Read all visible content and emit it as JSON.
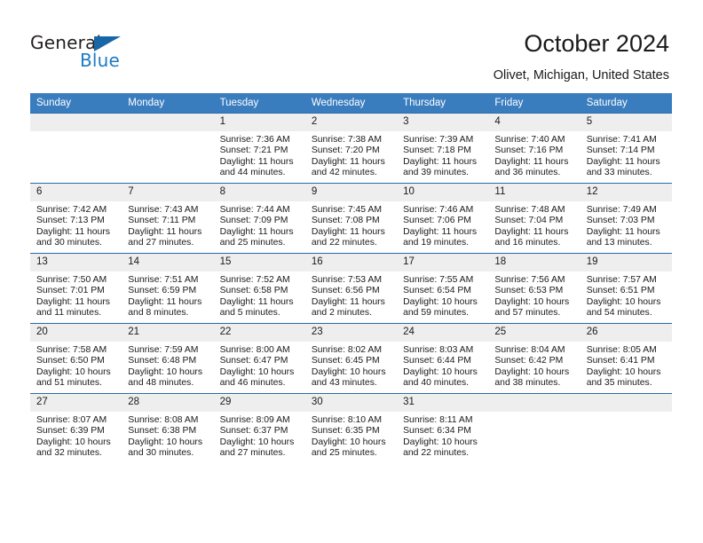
{
  "brand": {
    "name_part1": "General",
    "name_part2": "Blue",
    "logo_icon": "triangle-flag-icon",
    "accent_color": "#1b7bc4"
  },
  "header": {
    "title": "October 2024",
    "subtitle": "Olivet, Michigan, United States"
  },
  "colors": {
    "header_row": "#3a7dbf",
    "day_number_bg": "#eeeeee",
    "row_divider": "#2a6ba8",
    "text": "#1a1a1a"
  },
  "calendar": {
    "weekday_headers": [
      "Sunday",
      "Monday",
      "Tuesday",
      "Wednesday",
      "Thursday",
      "Friday",
      "Saturday"
    ],
    "weeks": [
      [
        {
          "day": "",
          "blank": true,
          "sunrise": "",
          "sunset": "",
          "daylight_line1": "",
          "daylight_line2": ""
        },
        {
          "day": "",
          "blank": true,
          "sunrise": "",
          "sunset": "",
          "daylight_line1": "",
          "daylight_line2": ""
        },
        {
          "day": "1",
          "blank": false,
          "sunrise": "Sunrise: 7:36 AM",
          "sunset": "Sunset: 7:21 PM",
          "daylight_line1": "Daylight: 11 hours",
          "daylight_line2": "and 44 minutes."
        },
        {
          "day": "2",
          "blank": false,
          "sunrise": "Sunrise: 7:38 AM",
          "sunset": "Sunset: 7:20 PM",
          "daylight_line1": "Daylight: 11 hours",
          "daylight_line2": "and 42 minutes."
        },
        {
          "day": "3",
          "blank": false,
          "sunrise": "Sunrise: 7:39 AM",
          "sunset": "Sunset: 7:18 PM",
          "daylight_line1": "Daylight: 11 hours",
          "daylight_line2": "and 39 minutes."
        },
        {
          "day": "4",
          "blank": false,
          "sunrise": "Sunrise: 7:40 AM",
          "sunset": "Sunset: 7:16 PM",
          "daylight_line1": "Daylight: 11 hours",
          "daylight_line2": "and 36 minutes."
        },
        {
          "day": "5",
          "blank": false,
          "sunrise": "Sunrise: 7:41 AM",
          "sunset": "Sunset: 7:14 PM",
          "daylight_line1": "Daylight: 11 hours",
          "daylight_line2": "and 33 minutes."
        }
      ],
      [
        {
          "day": "6",
          "blank": false,
          "sunrise": "Sunrise: 7:42 AM",
          "sunset": "Sunset: 7:13 PM",
          "daylight_line1": "Daylight: 11 hours",
          "daylight_line2": "and 30 minutes."
        },
        {
          "day": "7",
          "blank": false,
          "sunrise": "Sunrise: 7:43 AM",
          "sunset": "Sunset: 7:11 PM",
          "daylight_line1": "Daylight: 11 hours",
          "daylight_line2": "and 27 minutes."
        },
        {
          "day": "8",
          "blank": false,
          "sunrise": "Sunrise: 7:44 AM",
          "sunset": "Sunset: 7:09 PM",
          "daylight_line1": "Daylight: 11 hours",
          "daylight_line2": "and 25 minutes."
        },
        {
          "day": "9",
          "blank": false,
          "sunrise": "Sunrise: 7:45 AM",
          "sunset": "Sunset: 7:08 PM",
          "daylight_line1": "Daylight: 11 hours",
          "daylight_line2": "and 22 minutes."
        },
        {
          "day": "10",
          "blank": false,
          "sunrise": "Sunrise: 7:46 AM",
          "sunset": "Sunset: 7:06 PM",
          "daylight_line1": "Daylight: 11 hours",
          "daylight_line2": "and 19 minutes."
        },
        {
          "day": "11",
          "blank": false,
          "sunrise": "Sunrise: 7:48 AM",
          "sunset": "Sunset: 7:04 PM",
          "daylight_line1": "Daylight: 11 hours",
          "daylight_line2": "and 16 minutes."
        },
        {
          "day": "12",
          "blank": false,
          "sunrise": "Sunrise: 7:49 AM",
          "sunset": "Sunset: 7:03 PM",
          "daylight_line1": "Daylight: 11 hours",
          "daylight_line2": "and 13 minutes."
        }
      ],
      [
        {
          "day": "13",
          "blank": false,
          "sunrise": "Sunrise: 7:50 AM",
          "sunset": "Sunset: 7:01 PM",
          "daylight_line1": "Daylight: 11 hours",
          "daylight_line2": "and 11 minutes."
        },
        {
          "day": "14",
          "blank": false,
          "sunrise": "Sunrise: 7:51 AM",
          "sunset": "Sunset: 6:59 PM",
          "daylight_line1": "Daylight: 11 hours",
          "daylight_line2": "and 8 minutes."
        },
        {
          "day": "15",
          "blank": false,
          "sunrise": "Sunrise: 7:52 AM",
          "sunset": "Sunset: 6:58 PM",
          "daylight_line1": "Daylight: 11 hours",
          "daylight_line2": "and 5 minutes."
        },
        {
          "day": "16",
          "blank": false,
          "sunrise": "Sunrise: 7:53 AM",
          "sunset": "Sunset: 6:56 PM",
          "daylight_line1": "Daylight: 11 hours",
          "daylight_line2": "and 2 minutes."
        },
        {
          "day": "17",
          "blank": false,
          "sunrise": "Sunrise: 7:55 AM",
          "sunset": "Sunset: 6:54 PM",
          "daylight_line1": "Daylight: 10 hours",
          "daylight_line2": "and 59 minutes."
        },
        {
          "day": "18",
          "blank": false,
          "sunrise": "Sunrise: 7:56 AM",
          "sunset": "Sunset: 6:53 PM",
          "daylight_line1": "Daylight: 10 hours",
          "daylight_line2": "and 57 minutes."
        },
        {
          "day": "19",
          "blank": false,
          "sunrise": "Sunrise: 7:57 AM",
          "sunset": "Sunset: 6:51 PM",
          "daylight_line1": "Daylight: 10 hours",
          "daylight_line2": "and 54 minutes."
        }
      ],
      [
        {
          "day": "20",
          "blank": false,
          "sunrise": "Sunrise: 7:58 AM",
          "sunset": "Sunset: 6:50 PM",
          "daylight_line1": "Daylight: 10 hours",
          "daylight_line2": "and 51 minutes."
        },
        {
          "day": "21",
          "blank": false,
          "sunrise": "Sunrise: 7:59 AM",
          "sunset": "Sunset: 6:48 PM",
          "daylight_line1": "Daylight: 10 hours",
          "daylight_line2": "and 48 minutes."
        },
        {
          "day": "22",
          "blank": false,
          "sunrise": "Sunrise: 8:00 AM",
          "sunset": "Sunset: 6:47 PM",
          "daylight_line1": "Daylight: 10 hours",
          "daylight_line2": "and 46 minutes."
        },
        {
          "day": "23",
          "blank": false,
          "sunrise": "Sunrise: 8:02 AM",
          "sunset": "Sunset: 6:45 PM",
          "daylight_line1": "Daylight: 10 hours",
          "daylight_line2": "and 43 minutes."
        },
        {
          "day": "24",
          "blank": false,
          "sunrise": "Sunrise: 8:03 AM",
          "sunset": "Sunset: 6:44 PM",
          "daylight_line1": "Daylight: 10 hours",
          "daylight_line2": "and 40 minutes."
        },
        {
          "day": "25",
          "blank": false,
          "sunrise": "Sunrise: 8:04 AM",
          "sunset": "Sunset: 6:42 PM",
          "daylight_line1": "Daylight: 10 hours",
          "daylight_line2": "and 38 minutes."
        },
        {
          "day": "26",
          "blank": false,
          "sunrise": "Sunrise: 8:05 AM",
          "sunset": "Sunset: 6:41 PM",
          "daylight_line1": "Daylight: 10 hours",
          "daylight_line2": "and 35 minutes."
        }
      ],
      [
        {
          "day": "27",
          "blank": false,
          "sunrise": "Sunrise: 8:07 AM",
          "sunset": "Sunset: 6:39 PM",
          "daylight_line1": "Daylight: 10 hours",
          "daylight_line2": "and 32 minutes."
        },
        {
          "day": "28",
          "blank": false,
          "sunrise": "Sunrise: 8:08 AM",
          "sunset": "Sunset: 6:38 PM",
          "daylight_line1": "Daylight: 10 hours",
          "daylight_line2": "and 30 minutes."
        },
        {
          "day": "29",
          "blank": false,
          "sunrise": "Sunrise: 8:09 AM",
          "sunset": "Sunset: 6:37 PM",
          "daylight_line1": "Daylight: 10 hours",
          "daylight_line2": "and 27 minutes."
        },
        {
          "day": "30",
          "blank": false,
          "sunrise": "Sunrise: 8:10 AM",
          "sunset": "Sunset: 6:35 PM",
          "daylight_line1": "Daylight: 10 hours",
          "daylight_line2": "and 25 minutes."
        },
        {
          "day": "31",
          "blank": false,
          "sunrise": "Sunrise: 8:11 AM",
          "sunset": "Sunset: 6:34 PM",
          "daylight_line1": "Daylight: 10 hours",
          "daylight_line2": "and 22 minutes."
        },
        {
          "day": "",
          "blank": true,
          "sunrise": "",
          "sunset": "",
          "daylight_line1": "",
          "daylight_line2": ""
        },
        {
          "day": "",
          "blank": true,
          "sunrise": "",
          "sunset": "",
          "daylight_line1": "",
          "daylight_line2": ""
        }
      ]
    ]
  }
}
